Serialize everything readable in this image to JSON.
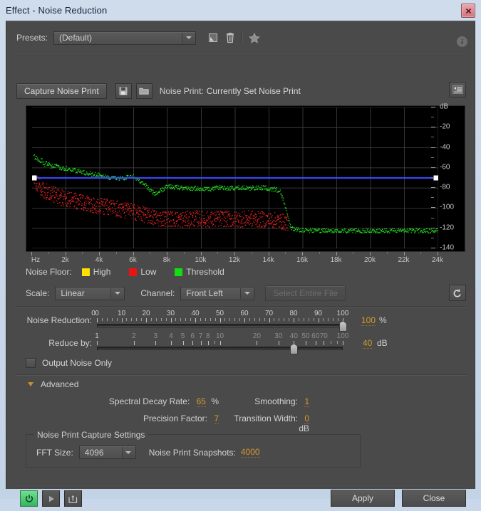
{
  "window": {
    "title": "Effect - Noise Reduction",
    "close_label": "x"
  },
  "presets": {
    "label": "Presets:",
    "value": "(Default)",
    "save_icon": "save-preset-icon",
    "delete_icon": "trash-icon",
    "favorite_icon": "star-icon",
    "info_icon": "info-icon",
    "info_glyph": "i"
  },
  "noise_print": {
    "capture_button": "Capture Noise Print",
    "save_icon": "save-noise-print-icon",
    "load_icon": "open-folder-icon",
    "label": "Noise Print:",
    "value": "Currently Set Noise Print",
    "menu_icon": "panel-menu-icon"
  },
  "chart_data": {
    "type": "scatter",
    "title": "",
    "xlabel": "Hz",
    "ylabel": "dB",
    "xlim": [
      0,
      24000
    ],
    "ylim": [
      -140,
      0
    ],
    "grid": true,
    "x_unit_label": "Hz",
    "y_unit_label": "dB",
    "x_ticks": [
      0,
      2000,
      4000,
      6000,
      8000,
      10000,
      12000,
      14000,
      16000,
      18000,
      20000,
      22000,
      24000
    ],
    "x_tick_labels": [
      "Hz",
      "2k",
      "4k",
      "6k",
      "8k",
      "10k",
      "12k",
      "14k",
      "16k",
      "18k",
      "20k",
      "22k",
      "24k"
    ],
    "y_ticks": [
      0,
      -20,
      -40,
      -60,
      -80,
      -100,
      -120,
      -140
    ],
    "y_tick_labels": [
      "dB",
      "-20",
      "-40",
      "-60",
      "-80",
      "-100",
      "-120",
      "-140"
    ],
    "series": [
      {
        "name": "Threshold",
        "color": "#22dd22",
        "style": "scatter",
        "description": "Noise floor threshold curve: starts about -48 dB at 100 Hz, descends to -70 dB by 5 kHz, dips to -86 dB near 7.3 kHz, plateaus around -80 dB from 8 k to 14.5 kHz, then drops sharply to about -122 dB and stays flat to 24 kHz",
        "points": [
          [
            90,
            -46
          ],
          [
            150,
            -50
          ],
          [
            260,
            -49
          ],
          [
            400,
            -53
          ],
          [
            560,
            -52
          ],
          [
            700,
            -56
          ],
          [
            900,
            -55
          ],
          [
            1100,
            -58
          ],
          [
            1400,
            -58
          ],
          [
            1700,
            -60
          ],
          [
            2000,
            -60
          ],
          [
            2400,
            -62
          ],
          [
            2800,
            -63
          ],
          [
            3200,
            -65
          ],
          [
            3600,
            -66
          ],
          [
            4000,
            -67
          ],
          [
            4400,
            -69
          ],
          [
            4800,
            -70
          ],
          [
            5200,
            -70
          ],
          [
            5600,
            -69
          ],
          [
            6000,
            -68
          ],
          [
            6400,
            -73
          ],
          [
            6800,
            -79
          ],
          [
            7200,
            -85
          ],
          [
            7600,
            -82
          ],
          [
            8000,
            -78
          ],
          [
            8600,
            -79
          ],
          [
            9200,
            -80
          ],
          [
            9800,
            -80
          ],
          [
            10400,
            -81
          ],
          [
            11000,
            -79
          ],
          [
            11600,
            -80
          ],
          [
            12200,
            -79
          ],
          [
            12800,
            -80
          ],
          [
            13400,
            -79
          ],
          [
            14000,
            -80
          ],
          [
            14600,
            -82
          ],
          [
            14900,
            -95
          ],
          [
            15100,
            -110
          ],
          [
            15300,
            -120
          ],
          [
            16000,
            -122
          ],
          [
            18000,
            -122
          ],
          [
            20000,
            -122
          ],
          [
            22000,
            -122
          ],
          [
            24000,
            -122
          ]
        ]
      },
      {
        "name": "Low",
        "color": "#dd2222",
        "style": "scatter",
        "description": "Low noise floor scatter: band from about -72 dB at 100 Hz falling to roughly -110 dB around 8 kHz and staying between -100 and -130 dB until it ends near 15.2 kHz",
        "points": [
          [
            90,
            -70
          ],
          [
            200,
            -74
          ],
          [
            350,
            -76
          ],
          [
            500,
            -80
          ],
          [
            700,
            -82
          ],
          [
            900,
            -84
          ],
          [
            1200,
            -85
          ],
          [
            1500,
            -88
          ],
          [
            1900,
            -90
          ],
          [
            2300,
            -92
          ],
          [
            2800,
            -93
          ],
          [
            3300,
            -95
          ],
          [
            3800,
            -97
          ],
          [
            4400,
            -98
          ],
          [
            5000,
            -100
          ],
          [
            5600,
            -102
          ],
          [
            6200,
            -104
          ],
          [
            6800,
            -107
          ],
          [
            7400,
            -110
          ],
          [
            8000,
            -110
          ],
          [
            8800,
            -111
          ],
          [
            9600,
            -110
          ],
          [
            10400,
            -111
          ],
          [
            11200,
            -110
          ],
          [
            12000,
            -111
          ],
          [
            12800,
            -110
          ],
          [
            13600,
            -111
          ],
          [
            14400,
            -112
          ],
          [
            15100,
            -114
          ]
        ]
      },
      {
        "name": "High",
        "color": "#ffe000",
        "style": "scatter",
        "description": "High noise floor series (enabled in legend, not prominently drawn in this view)",
        "points": []
      },
      {
        "name": "Threshold line",
        "color": "#3b4bff",
        "style": "line",
        "description": "User-adjustable flat threshold/reduction line held at about -70 dB across the whole spectrum, with white square drag handles at each end",
        "points": [
          [
            0,
            -70
          ],
          [
            24000,
            -70
          ]
        ],
        "handles": [
          [
            0,
            -70
          ],
          [
            24000,
            -70
          ]
        ]
      }
    ],
    "legend": {
      "position": "below-plot",
      "title": "Noise Floor:",
      "entries": [
        {
          "label": "High",
          "color": "#ffe000"
        },
        {
          "label": "Low",
          "color": "#ee1111"
        },
        {
          "label": "Threshold",
          "color": "#11dd11"
        }
      ]
    }
  },
  "scale_row": {
    "scale_label": "Scale:",
    "scale_value": "Linear",
    "channel_label": "Channel:",
    "channel_value": "Front Left",
    "select_entire_file": "Select Entire File",
    "reset_icon": "reset-icon"
  },
  "sliders": {
    "noise_reduction": {
      "label": "Noise Reduction:",
      "value": "100",
      "unit": "%",
      "min": 0,
      "max": 100,
      "ticks": [
        "0",
        "0",
        "10",
        "20",
        "30",
        "40",
        "50",
        "60",
        "70",
        "80",
        "90",
        "100"
      ],
      "thumb_percent": 100
    },
    "reduce_by": {
      "label": "Reduce by:",
      "value": "40",
      "unit": "dB",
      "min": 1,
      "max": 100,
      "scale": "logarithmic",
      "ticks": [
        "1",
        "2",
        "3",
        "4",
        "5",
        "6",
        "7",
        "8",
        "10",
        "20",
        "30",
        "40",
        "50",
        "60",
        "70",
        "100"
      ],
      "thumb_percent": 80
    }
  },
  "output_noise_only": {
    "label": "Output Noise Only",
    "checked": false
  },
  "advanced": {
    "label": "Advanced",
    "expanded": true,
    "fields": [
      {
        "label": "Spectral Decay Rate:",
        "value": "65",
        "unit": "%"
      },
      {
        "label": "Smoothing:",
        "value": "1",
        "unit": ""
      },
      {
        "label": "Precision Factor:",
        "value": "7",
        "unit": ""
      },
      {
        "label": "Transition Width:",
        "value": "0",
        "unit": "dB"
      }
    ],
    "capture_group": {
      "title": "Noise Print Capture Settings",
      "fft_label": "FFT Size:",
      "fft_value": "4096",
      "snapshots_label": "Noise Print Snapshots:",
      "snapshots_value": "4000"
    }
  },
  "footer": {
    "power_icon": "power-toggle-icon",
    "play_icon": "play-icon",
    "loop_icon": "export-icon",
    "apply_label": "Apply",
    "close_label": "Close"
  },
  "colors": {
    "dialog_bg": "#4a4a4a",
    "titlebar": "#c9d9ec",
    "value_orange": "#d59b2c",
    "plot_bg": "#000000",
    "grid": "#4a4a4a",
    "threshold_green": "#22dd22",
    "low_red": "#dd2222",
    "high_yellow": "#ffe000",
    "threshold_line_blue": "#3b4bff"
  }
}
